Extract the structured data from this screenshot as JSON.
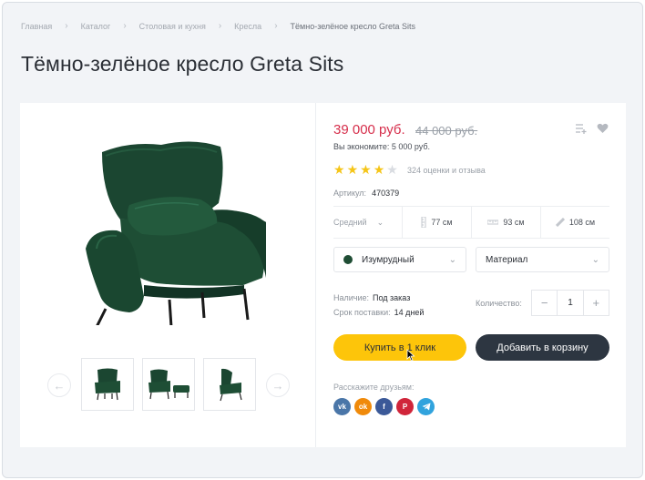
{
  "breadcrumbs": [
    "Главная",
    "Каталог",
    "Столовая и кухня",
    "Кресла",
    "Тёмно-зелёное кресло Greta Sits"
  ],
  "title": "Тёмно-зелёное кресло Greta Sits",
  "price": "39 000 руб.",
  "old_price": "44 000 руб.",
  "savings": "Вы экономите: 5 000 руб.",
  "rating": {
    "value": 4,
    "max": 5,
    "reviews": "324 оценки и отзыва"
  },
  "article": {
    "label": "Артикул:",
    "value": "470379"
  },
  "params": {
    "size_select": "Средний",
    "height": "77 см",
    "depth": "93 см",
    "width": "108 см"
  },
  "color_select": {
    "value": "Изумрудный",
    "swatch": "#1f4d34"
  },
  "material_select": {
    "value": "Материал"
  },
  "availability": {
    "label": "Наличие:",
    "value": "Под заказ"
  },
  "delivery": {
    "label": "Срок поставки:",
    "value": "14 дней"
  },
  "quantity": {
    "label": "Количество:",
    "value": "1",
    "minus": "−",
    "plus": "+"
  },
  "buttons": {
    "buy_one_click": "Купить в 1 клик",
    "add_to_cart": "Добавить в корзину"
  },
  "share": {
    "label": "Расскажите друзьям:",
    "networks": [
      "vk",
      "ok",
      "f",
      "P",
      "tg"
    ]
  },
  "colors": {
    "accent_yellow": "#fdc50a",
    "dark_button": "#2d3641",
    "price_red": "#d62e4b",
    "star": "#f5c518",
    "vk": "#4a76a8",
    "ok": "#f08a0a",
    "fb": "#3b5998",
    "pinterest": "#d0253a",
    "telegram": "#31a3dd"
  }
}
